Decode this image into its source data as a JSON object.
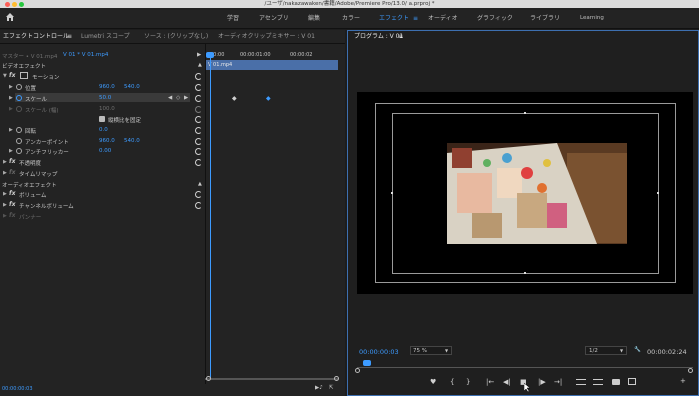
{
  "window": {
    "title": "/ユーザ/nakazawaken/書籍/Adobe/Premiere Pro/13.0/ a.prproj *"
  },
  "workspaces": [
    "学習",
    "アセンブリ",
    "編集",
    "カラー",
    "エフェクト",
    "オーディオ",
    "グラフィック",
    "ライブラリ",
    "Learning"
  ],
  "active_workspace": "エフェクト",
  "left_tabs": {
    "effect_controls": "エフェクトコントロール",
    "lumetri": "Lumetri スコープ",
    "source": "ソース : (クリップなし)",
    "audio_mixer": "オーディオクリップミキサー : V 01"
  },
  "effect_controls": {
    "master": "マスター • V 01.mp4",
    "sequence": "V 01 * V 01.mp4",
    "timecode_start": "00:00",
    "timecode_mid": "00:00:01:00",
    "timecode_end": "00:00:02",
    "clip_label": "V 01.mp4",
    "video_effects": "ビデオエフェクト",
    "motion": "モーション",
    "position": {
      "label": "位置",
      "x": "960.0",
      "y": "540.0"
    },
    "scale": {
      "label": "スケール",
      "value": "50.0"
    },
    "scale_width": {
      "label": "スケール (幅)",
      "value": "100.0"
    },
    "uniform_scale": "縦横比を固定",
    "rotation": {
      "label": "回転",
      "value": "0.0"
    },
    "anchor": {
      "label": "アンカーポイント",
      "x": "960.0",
      "y": "540.0"
    },
    "antiflicker": {
      "label": "アンチフリッカー",
      "value": "0.00"
    },
    "opacity": "不透明度",
    "time_remap": "タイムリマップ",
    "audio_effects": "オーディオエフェクト",
    "volume": "ボリューム",
    "channel_volume": "チャンネルボリューム",
    "panner": "パンナー",
    "bottom_timecode": "00:00:00:03"
  },
  "program": {
    "tab": "プログラム : V 01",
    "timecode": "00:00:00:03",
    "zoom": "75 %",
    "resolution": "1/2",
    "duration": "00:00:02:24"
  },
  "icons": {
    "marker": "♥",
    "in": "{",
    "out": "}",
    "go_in": "|←",
    "step_back": "◀|",
    "stop": "■",
    "step_fwd": "|▶",
    "go_out": "→|",
    "add": "+"
  },
  "colors": {
    "accent": "#3d9bff",
    "panel": "#232323",
    "bg": "#1d1d1d"
  }
}
